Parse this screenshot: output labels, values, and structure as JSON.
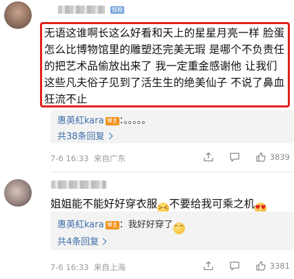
{
  "comments": [
    {
      "fan_badge": "铁粉",
      "text": "无语这谁啊长这么好看和天上的星星月亮一样 脸蛋怎么比博物馆里的雕塑还完美无瑕 是哪个不负责任的把艺术品偷放出来了 我一定重金感谢他 让我们这些凡夫俗子见到了活生生的绝美仙子 不说了鼻血狂流不止",
      "reply": {
        "user": "惠英紅kara",
        "author_badge": "博主",
        "text": "：。。。。。",
        "count": "共38条回复"
      },
      "time": "7-6 16:33",
      "location": "来自广东",
      "likes": "3839"
    },
    {
      "text_before": "姐姐能不能好好穿衣服",
      "text_middle": "不要给我可乘之机",
      "emoji_1": "tired-face-emoji",
      "emoji_2": "heart-eyes-emoji",
      "reply": {
        "user": "惠英紅kara",
        "author_badge": "博主",
        "text": "：我好好穿了",
        "count": "共4条回复"
      },
      "reply_emoji": "sweat-smile-emoji",
      "time": "7-6 16:33",
      "location": "来自上海",
      "likes": "3381"
    }
  ],
  "icons": [
    "share-icon",
    "comment-icon",
    "like-icon"
  ]
}
